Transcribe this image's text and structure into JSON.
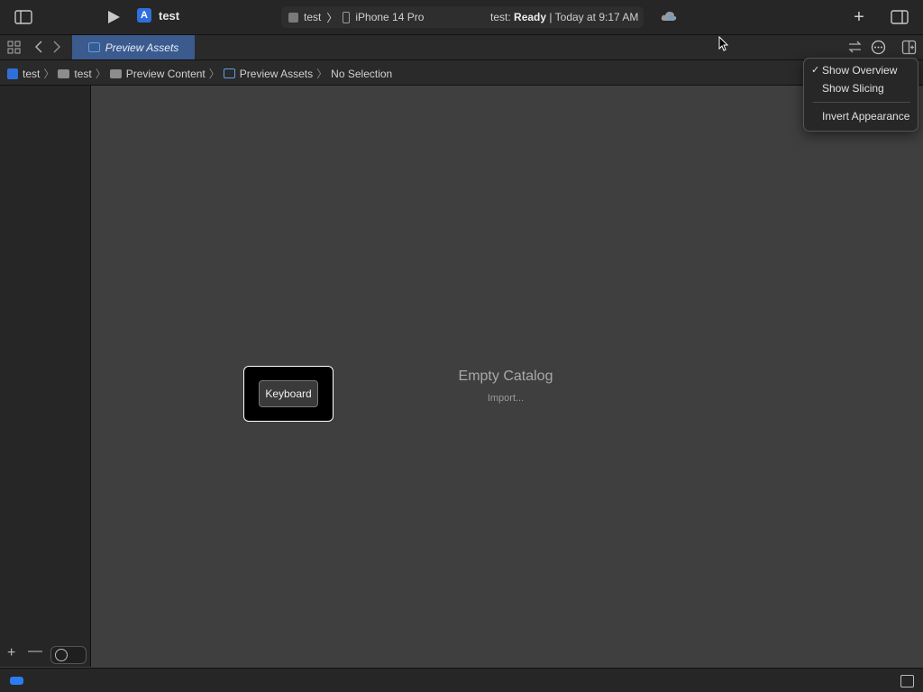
{
  "toolbar": {
    "project_name": "test",
    "scheme": {
      "target": "test",
      "device": "iPhone 14 Pro",
      "status_prefix": "test:",
      "status_state": "Ready",
      "status_time": "| Today at 9:17 AM"
    },
    "add_label": "+"
  },
  "tabbar": {
    "active_tab": "Preview Assets"
  },
  "breadcrumb": {
    "items": [
      "test",
      "test",
      "Preview Content",
      "Preview Assets",
      "No Selection"
    ],
    "separator": "〉"
  },
  "content": {
    "empty_title": "Empty Catalog",
    "import_label": "Import..."
  },
  "keyboard_overlay": {
    "label": "Keyboard"
  },
  "sidebar": {
    "add_label": "+",
    "remove_label": "—"
  },
  "menu": {
    "items": [
      {
        "label": "Show Overview",
        "checked": "✓"
      },
      {
        "label": "Show Slicing",
        "checked": ""
      },
      {
        "label": "Invert Appearance",
        "checked": ""
      }
    ]
  },
  "colors": {
    "accent": "#2f6fdb",
    "active_tab": "#3b5a8e",
    "background": "#3f3f3f"
  }
}
